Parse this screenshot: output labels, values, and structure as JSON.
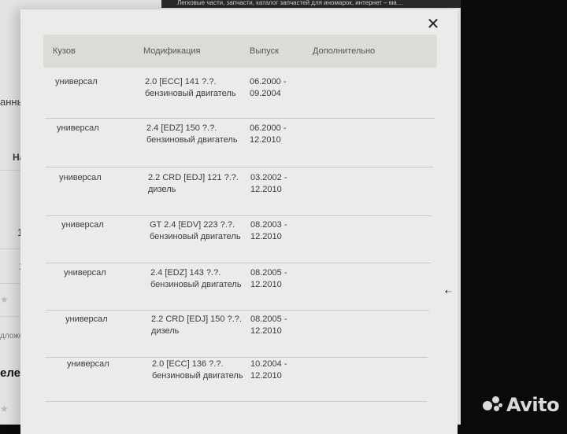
{
  "background_page": {
    "tab_title": "Легковые части, запчасти, каталог запчастей для иномарок, интернет – ма…",
    "fragments": [
      "анны",
      "На",
      "1 ш",
      "10",
      "1 ш",
      "дложен",
      "елей",
      "7 ш"
    ]
  },
  "modal": {
    "close_icon": "close-icon",
    "columns": [
      "Кузов",
      "Модификация",
      "Выпуск",
      "Дополнительно"
    ],
    "rows": [
      {
        "body": "универсал",
        "mod": [
          "2.0 [ECC] 141 ?.?.",
          "бензиновый двигатель"
        ],
        "release": [
          "06.2000 -",
          "09.2004"
        ]
      },
      {
        "body": "универсал",
        "mod": [
          "2.4 [EDZ] 150 ?.?.",
          "бензиновый двигатель"
        ],
        "release": [
          "06.2000 -",
          "12.2010"
        ]
      },
      {
        "body": "универсал",
        "mod": [
          "2.2 CRD [EDJ] 121 ?.?.",
          "дизель"
        ],
        "release": [
          "03.2002 -",
          "12.2010"
        ]
      },
      {
        "body": "универсал",
        "mod": [
          "GT 2.4 [EDV] 223 ?.?.",
          "бензиновый двигатель"
        ],
        "release": [
          "08.2003 -",
          "12.2010"
        ]
      },
      {
        "body": "универсал",
        "mod": [
          "2.4 [EDZ] 143 ?.?.",
          "бензиновый двигатель"
        ],
        "release": [
          "08.2005 -",
          "12.2010"
        ]
      },
      {
        "body": "универсал",
        "mod": [
          "2.2 CRD [EDJ] 150 ?.?.",
          "дизель"
        ],
        "release": [
          "08.2005 -",
          "12.2010"
        ]
      },
      {
        "body": "универсал",
        "mod": [
          "2.0 [ECC] 136 ?.?.",
          "бензиновый двигатель"
        ],
        "release": [
          "10.2004 -",
          "12.2010"
        ]
      }
    ]
  },
  "watermark": {
    "logo": "avito-logo",
    "text": "Avito"
  }
}
